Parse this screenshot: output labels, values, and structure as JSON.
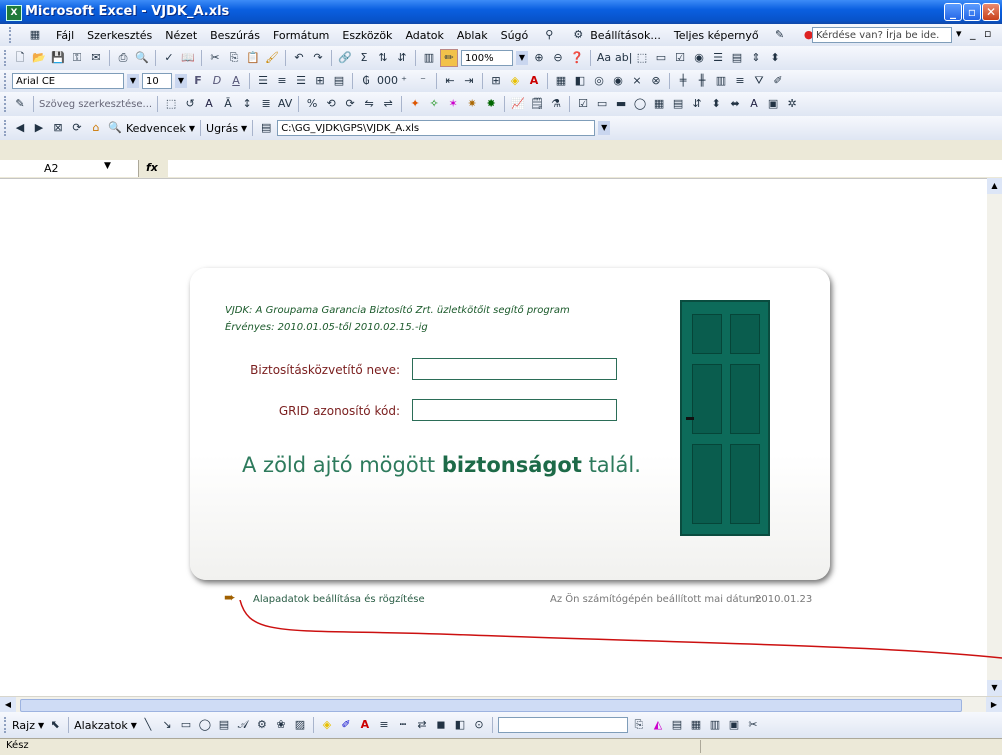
{
  "window": {
    "title": "Microsoft Excel - VJDK_A.xls",
    "minimize": "_",
    "restore": "▫",
    "close": "✕"
  },
  "menu": {
    "items": [
      "Fájl",
      "Szerkesztés",
      "Nézet",
      "Beszúrás",
      "Formátum",
      "Eszközök",
      "Adatok",
      "Ablak",
      "Súgó",
      "Beállítások...",
      "Teljes képernyő"
    ],
    "help_placeholder": "Kérdése van? Írja be ide."
  },
  "standard_toolbar": {
    "zoom": "100%"
  },
  "format_toolbar": {
    "font": "Arial CE",
    "size": "10",
    "bold": "F",
    "italic": "D",
    "underline": "A"
  },
  "drawing_toolbar_top": {
    "text_edit": "Szöveg szerkesztése..."
  },
  "web_toolbar": {
    "favorites": "Kedvencek",
    "goto": "Ugrás",
    "path": "C:\\GG_VJDK\\GPS\\VJDK_A.xls"
  },
  "formula_bar": {
    "cell": "A2",
    "fx": "fx"
  },
  "form": {
    "intro_line1": "VJDK: A Groupama Garancia Biztosító Zrt. üzletkötőit segítő program",
    "intro_line2": "Érvényes:  2010.01.05-től  2010.02.15.-ig",
    "broker_label": "Biztosításközvetítő neve:",
    "broker_value": "",
    "grid_label": "GRID azonosító kód:",
    "grid_value": "",
    "slogan_normal": "A zöld ajtó mögött ",
    "slogan_bold": "biztonságot",
    "slogan_end": " talál.",
    "setup_link": "Alapadatok beállítása és rögzítése",
    "date_label": "Az Ön számítógépén beállított mai dátum:",
    "date_value": "2010.01.23"
  },
  "draw_toolbar": {
    "draw": "Rajz",
    "shapes": "Alakzatok"
  },
  "status": {
    "text": "Kész"
  },
  "colors": {
    "door": "#0d6b5a",
    "label_red": "#7a1e1e",
    "intro_green": "#1b5a2b",
    "slogan_green": "#2d7a5c"
  }
}
